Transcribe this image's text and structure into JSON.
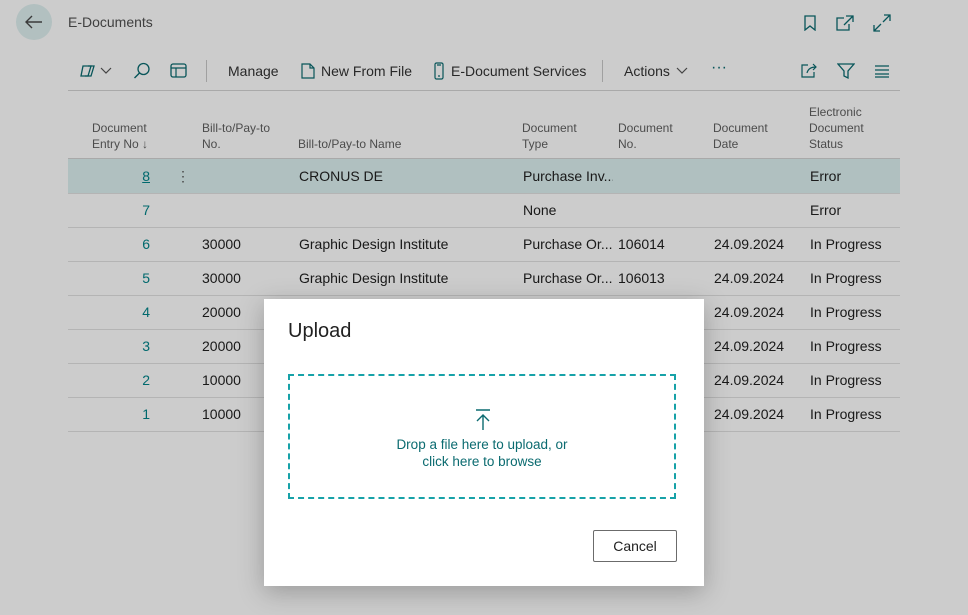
{
  "header": {
    "title": "E-Documents"
  },
  "toolbar": {
    "manage": "Manage",
    "new_from_file": "New From File",
    "services": "E-Document Services",
    "actions": "Actions",
    "more": "···"
  },
  "columns": {
    "entry_no_l1": "Document",
    "entry_no_l2": "Entry No ↓",
    "billto_no_l1": "Bill-to/Pay-to",
    "billto_no_l2": "No.",
    "billto_name": "Bill-to/Pay-to Name",
    "doc_type_l1": "Document",
    "doc_type_l2": "Type",
    "doc_no_l1": "Document",
    "doc_no_l2": "No.",
    "doc_date_l1": "Document",
    "doc_date_l2": "Date",
    "status_l1": "Electronic",
    "status_l2": "Document",
    "status_l3": "Status"
  },
  "rows": [
    {
      "entry": "8",
      "billto_no": "",
      "name": "CRONUS DE",
      "type": "Purchase Inv...",
      "doc_no": "",
      "date": "",
      "status": "Error"
    },
    {
      "entry": "7",
      "billto_no": "",
      "name": "",
      "type": "None",
      "doc_no": "",
      "date": "",
      "status": "Error"
    },
    {
      "entry": "6",
      "billto_no": "30000",
      "name": "Graphic Design Institute",
      "type": "Purchase Or...",
      "doc_no": "106014",
      "date": "24.09.2024",
      "status": "In Progress"
    },
    {
      "entry": "5",
      "billto_no": "30000",
      "name": "Graphic Design Institute",
      "type": "Purchase Or...",
      "doc_no": "106013",
      "date": "24.09.2024",
      "status": "In Progress"
    },
    {
      "entry": "4",
      "billto_no": "20000",
      "name": "",
      "type": "",
      "doc_no": "",
      "date": "24.09.2024",
      "status": "In Progress"
    },
    {
      "entry": "3",
      "billto_no": "20000",
      "name": "",
      "type": "",
      "doc_no": "",
      "date": "24.09.2024",
      "status": "In Progress"
    },
    {
      "entry": "2",
      "billto_no": "10000",
      "name": "",
      "type": "",
      "doc_no": "",
      "date": "24.09.2024",
      "status": "In Progress"
    },
    {
      "entry": "1",
      "billto_no": "10000",
      "name": "",
      "type": "",
      "doc_no": "",
      "date": "24.09.2024",
      "status": "In Progress"
    }
  ],
  "dialog": {
    "title": "Upload",
    "drop_line1": "Drop a file here to upload, or",
    "drop_line2": "click here to browse",
    "cancel": "Cancel"
  },
  "colors": {
    "accent": "#008489",
    "selected_row": "#dcf0f0",
    "dropzone_border": "#17a2a8"
  }
}
